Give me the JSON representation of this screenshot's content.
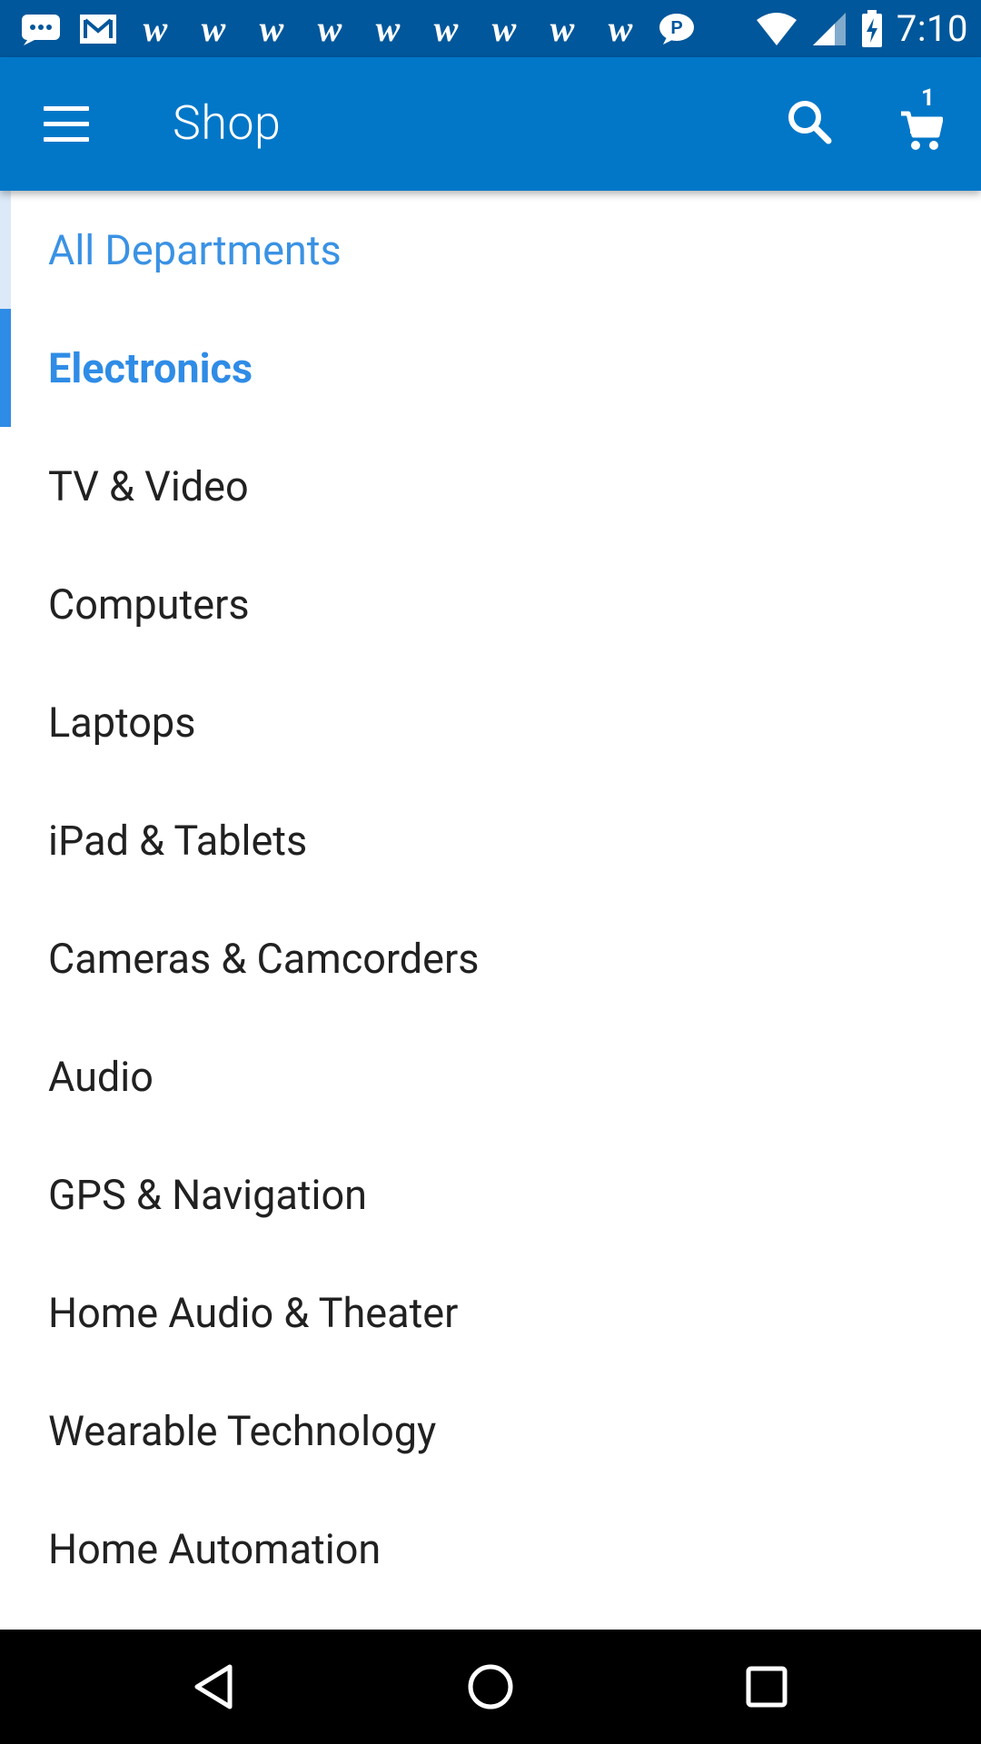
{
  "status_bar": {
    "time": "7:10",
    "notification_icons": [
      "message-icon",
      "gmail-icon",
      "w",
      "w",
      "w",
      "w",
      "w",
      "w",
      "w",
      "w",
      "w",
      "chat-bubble-icon"
    ],
    "w_glyph": "w",
    "system_icons": [
      "wifi-icon",
      "signal-icon",
      "battery-charging-icon"
    ]
  },
  "appbar": {
    "title": "Shop",
    "cart_count": "1",
    "menu_icon": "hamburger-menu-icon",
    "search_icon": "search-icon",
    "cart_icon": "shopping-cart-icon"
  },
  "departments": {
    "all_label": "All Departments",
    "active_label": "Electronics",
    "items": [
      "TV & Video",
      "Computers",
      "Laptops",
      "iPad & Tablets",
      "Cameras & Camcorders",
      "Audio",
      "GPS & Navigation",
      "Home Audio & Theater",
      "Wearable Technology",
      "Home Automation"
    ]
  },
  "colors": {
    "status_bar": "#01579b",
    "app_bar": "#0277c8",
    "accent": "#2f8ce6",
    "text": "#212121"
  },
  "nav_bar": {
    "buttons": [
      "back-icon",
      "home-icon",
      "recent-apps-icon"
    ]
  }
}
